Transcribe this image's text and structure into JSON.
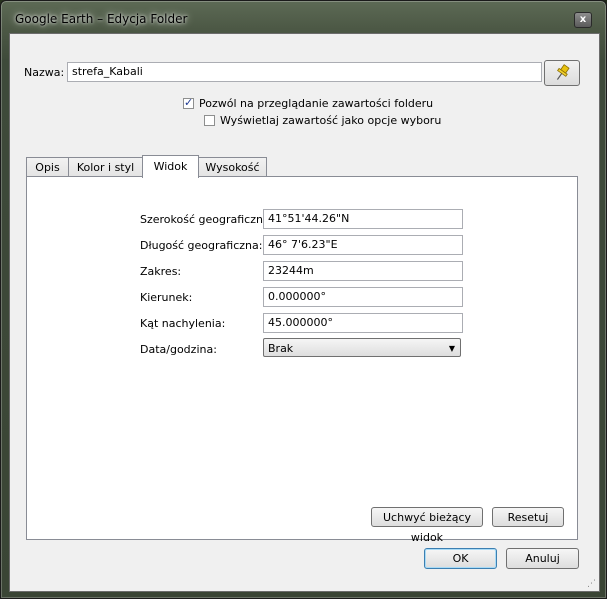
{
  "window": {
    "title": "Google Earth – Edycja Folder",
    "close_glyph": "x"
  },
  "name_field": {
    "label": "Nazwa:",
    "value": "strefa_Kabali"
  },
  "pin_button": {
    "icon": "pushpin-icon",
    "color": "#e8c20f"
  },
  "options": {
    "allow_browse": {
      "label": "Pozwól na przeglądanie zawartości folderu",
      "checked": true
    },
    "show_as_options": {
      "label": "Wyświetlaj zawartość jako opcje wyboru",
      "checked": false
    }
  },
  "tabs": [
    {
      "label": "Opis",
      "active": false
    },
    {
      "label": "Kolor i styl",
      "active": false
    },
    {
      "label": "Widok",
      "active": true
    },
    {
      "label": "Wysokość",
      "active": false
    }
  ],
  "view": {
    "latitude": {
      "label": "Szerokość geograficzna:",
      "value": "41°51'44.26\"N"
    },
    "longitude": {
      "label": "Długość geograficzna:",
      "value": "46° 7'6.23\"E"
    },
    "range": {
      "label": "Zakres:",
      "value": "23244m"
    },
    "heading": {
      "label": "Kierunek:",
      "value": "0.000000°"
    },
    "tilt": {
      "label": "Kąt nachylenia:",
      "value": "45.000000°"
    },
    "datetime": {
      "label": "Data/godzina:",
      "value": "Brak"
    },
    "capture_label": "Uchwyć bieżący widok",
    "reset_label": "Resetuj"
  },
  "footer": {
    "ok_label": "OK",
    "cancel_label": "Anuluj"
  }
}
